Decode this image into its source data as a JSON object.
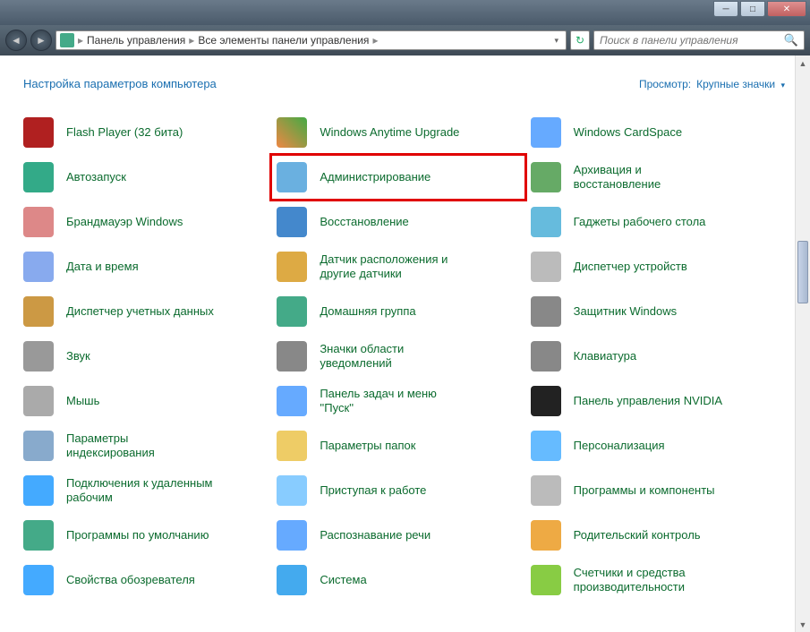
{
  "breadcrumb": {
    "seg1": "Панель управления",
    "seg2": "Все элементы панели управления"
  },
  "search": {
    "placeholder": "Поиск в панели управления"
  },
  "page_title": "Настройка параметров компьютера",
  "view": {
    "label": "Просмотр:",
    "value": "Крупные значки"
  },
  "items": [
    {
      "label": "Flash Player (32 бита)",
      "cls": "ic-flash"
    },
    {
      "label": "Windows Anytime Upgrade",
      "cls": "ic-upgrade"
    },
    {
      "label": "Windows CardSpace",
      "cls": "ic-card"
    },
    {
      "label": "Автозапуск",
      "cls": "ic-auto"
    },
    {
      "label": "Администрирование",
      "cls": "ic-admin",
      "hl": true
    },
    {
      "label": "Архивация и восстановление",
      "cls": "ic-backup"
    },
    {
      "label": "Брандмауэр Windows",
      "cls": "ic-fw"
    },
    {
      "label": "Восстановление",
      "cls": "ic-restore"
    },
    {
      "label": "Гаджеты рабочего стола",
      "cls": "ic-gadget"
    },
    {
      "label": "Дата и время",
      "cls": "ic-date"
    },
    {
      "label": "Датчик расположения и другие датчики",
      "cls": "ic-sensor"
    },
    {
      "label": "Диспетчер устройств",
      "cls": "ic-devmgr"
    },
    {
      "label": "Диспетчер учетных данных",
      "cls": "ic-cred"
    },
    {
      "label": "Домашняя группа",
      "cls": "ic-home"
    },
    {
      "label": "Защитник Windows",
      "cls": "ic-def"
    },
    {
      "label": "Звук",
      "cls": "ic-sound"
    },
    {
      "label": "Значки области уведомлений",
      "cls": "ic-notif"
    },
    {
      "label": "Клавиатура",
      "cls": "ic-kbd"
    },
    {
      "label": "Мышь",
      "cls": "ic-mouse"
    },
    {
      "label": "Панель задач и меню ''Пуск''",
      "cls": "ic-task"
    },
    {
      "label": "Панель управления NVIDIA",
      "cls": "ic-nv"
    },
    {
      "label": "Параметры индексирования",
      "cls": "ic-idx"
    },
    {
      "label": "Параметры папок",
      "cls": "ic-folder"
    },
    {
      "label": "Персонализация",
      "cls": "ic-pers"
    },
    {
      "label": "Подключения к удаленным рабочим",
      "cls": "ic-rdp"
    },
    {
      "label": "Приступая к работе",
      "cls": "ic-start"
    },
    {
      "label": "Программы и компоненты",
      "cls": "ic-prog"
    },
    {
      "label": "Программы по умолчанию",
      "cls": "ic-defprog"
    },
    {
      "label": "Распознавание речи",
      "cls": "ic-speech"
    },
    {
      "label": "Родительский контроль",
      "cls": "ic-parent"
    },
    {
      "label": "Свойства обозревателя",
      "cls": "ic-ie"
    },
    {
      "label": "Система",
      "cls": "ic-sys"
    },
    {
      "label": "Счетчики и средства производительности",
      "cls": "ic-perf"
    }
  ]
}
